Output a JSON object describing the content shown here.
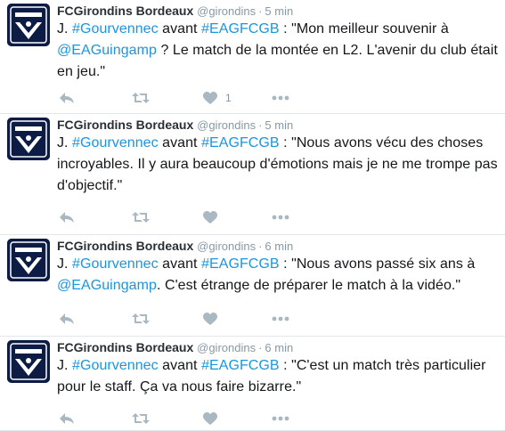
{
  "tweets": [
    {
      "name": "FCGirondins Bordeaux",
      "handle": "@girondins",
      "sep": "·",
      "time": "5 min",
      "avatar_text": "GIRONDINS DE BORDEAUX",
      "text_parts": [
        {
          "t": "J. ",
          "link": false
        },
        {
          "t": "#Gourvennec",
          "link": true
        },
        {
          "t": " avant ",
          "link": false
        },
        {
          "t": "#EAGFCGB",
          "link": true
        },
        {
          "t": " : \"Mon meilleur souvenir à ",
          "link": false
        },
        {
          "t": "@EAGuingamp",
          "link": true
        },
        {
          "t": " ? Le match de la montée en L2. L'avenir du club était en jeu.\"",
          "link": false
        }
      ],
      "like_count": "1"
    },
    {
      "name": "FCGirondins Bordeaux",
      "handle": "@girondins",
      "sep": "·",
      "time": "5 min",
      "avatar_text": "GIRONDINS DE BORDEAUX",
      "text_parts": [
        {
          "t": "J. ",
          "link": false
        },
        {
          "t": "#Gourvennec",
          "link": true
        },
        {
          "t": " avant ",
          "link": false
        },
        {
          "t": "#EAGFCGB",
          "link": true
        },
        {
          "t": " : \"Nous avons vécu des choses incroyables. Il y aura beaucoup d'émotions mais je ne me trompe pas d'objectif.\"",
          "link": false
        }
      ],
      "like_count": ""
    },
    {
      "name": "FCGirondins Bordeaux",
      "handle": "@girondins",
      "sep": "·",
      "time": "6 min",
      "avatar_text": "GIRONDINS DE BORDEAUX",
      "text_parts": [
        {
          "t": "J. ",
          "link": false
        },
        {
          "t": "#Gourvennec",
          "link": true
        },
        {
          "t": " avant ",
          "link": false
        },
        {
          "t": "#EAGFCGB",
          "link": true
        },
        {
          "t": " : \"Nous avons passé six ans à ",
          "link": false
        },
        {
          "t": "@EAGuingamp",
          "link": true
        },
        {
          "t": ". C'est étrange de préparer le match à la vidéo.\"",
          "link": false
        }
      ],
      "like_count": ""
    },
    {
      "name": "FCGirondins Bordeaux",
      "handle": "@girondins",
      "sep": "·",
      "time": "6 min",
      "avatar_text": "GIRONDINS DE BORDEAUX",
      "text_parts": [
        {
          "t": "J. ",
          "link": false
        },
        {
          "t": "#Gourvennec",
          "link": true
        },
        {
          "t": " avant ",
          "link": false
        },
        {
          "t": "#EAGFCGB",
          "link": true
        },
        {
          "t": " : \"C'est un match très particulier pour le staff. Ça va nous faire bizarre.\"",
          "link": false
        }
      ],
      "like_count": ""
    }
  ],
  "icons": {
    "reply": "reply-icon",
    "retweet": "retweet-icon",
    "like": "heart-icon",
    "more": "more-icon"
  },
  "colors": {
    "link": "#1b95e0",
    "avatar_bg": "#0c1c44",
    "action_gray": "#aab8c2",
    "meta_gray": "#8899a6"
  }
}
